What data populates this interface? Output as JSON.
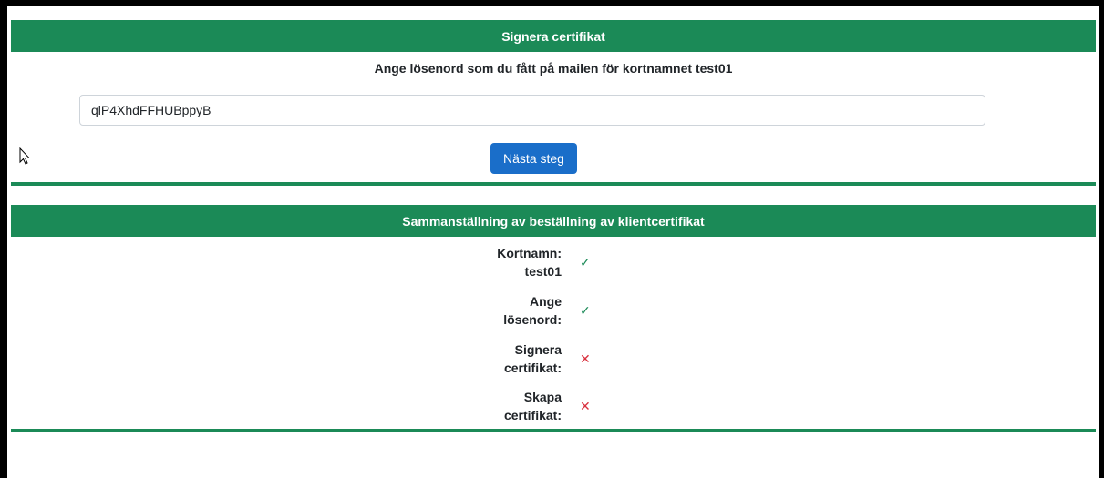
{
  "sign_panel": {
    "title": "Signera certifikat",
    "instruction": "Ange lösenord som du fått på mailen för kortnamnet test01",
    "password_value": "qlP4XhdFFHUBppyB",
    "next_button_label": "Nästa steg"
  },
  "summary_panel": {
    "title": "Sammanställning av beställning av klientcertifikat",
    "items": [
      {
        "label_line1": "Kortnamn:",
        "label_line2": "test01",
        "status": "done",
        "icon": "check-icon",
        "glyph": "✓"
      },
      {
        "label_line1": "Ange",
        "label_line2": "lösenord:",
        "status": "done",
        "icon": "check-icon",
        "glyph": "✓"
      },
      {
        "label_line1": "Signera",
        "label_line2": "certifikat:",
        "status": "pending",
        "icon": "cross-icon",
        "glyph": "✕"
      },
      {
        "label_line1": "Skapa",
        "label_line2": "certifikat:",
        "status": "pending",
        "icon": "cross-icon",
        "glyph": "✕"
      }
    ]
  },
  "colors": {
    "header_green": "#1b8a57",
    "button_blue": "#1a6ec9",
    "check_green": "#1b8a57",
    "cross_red": "#d9303e"
  }
}
